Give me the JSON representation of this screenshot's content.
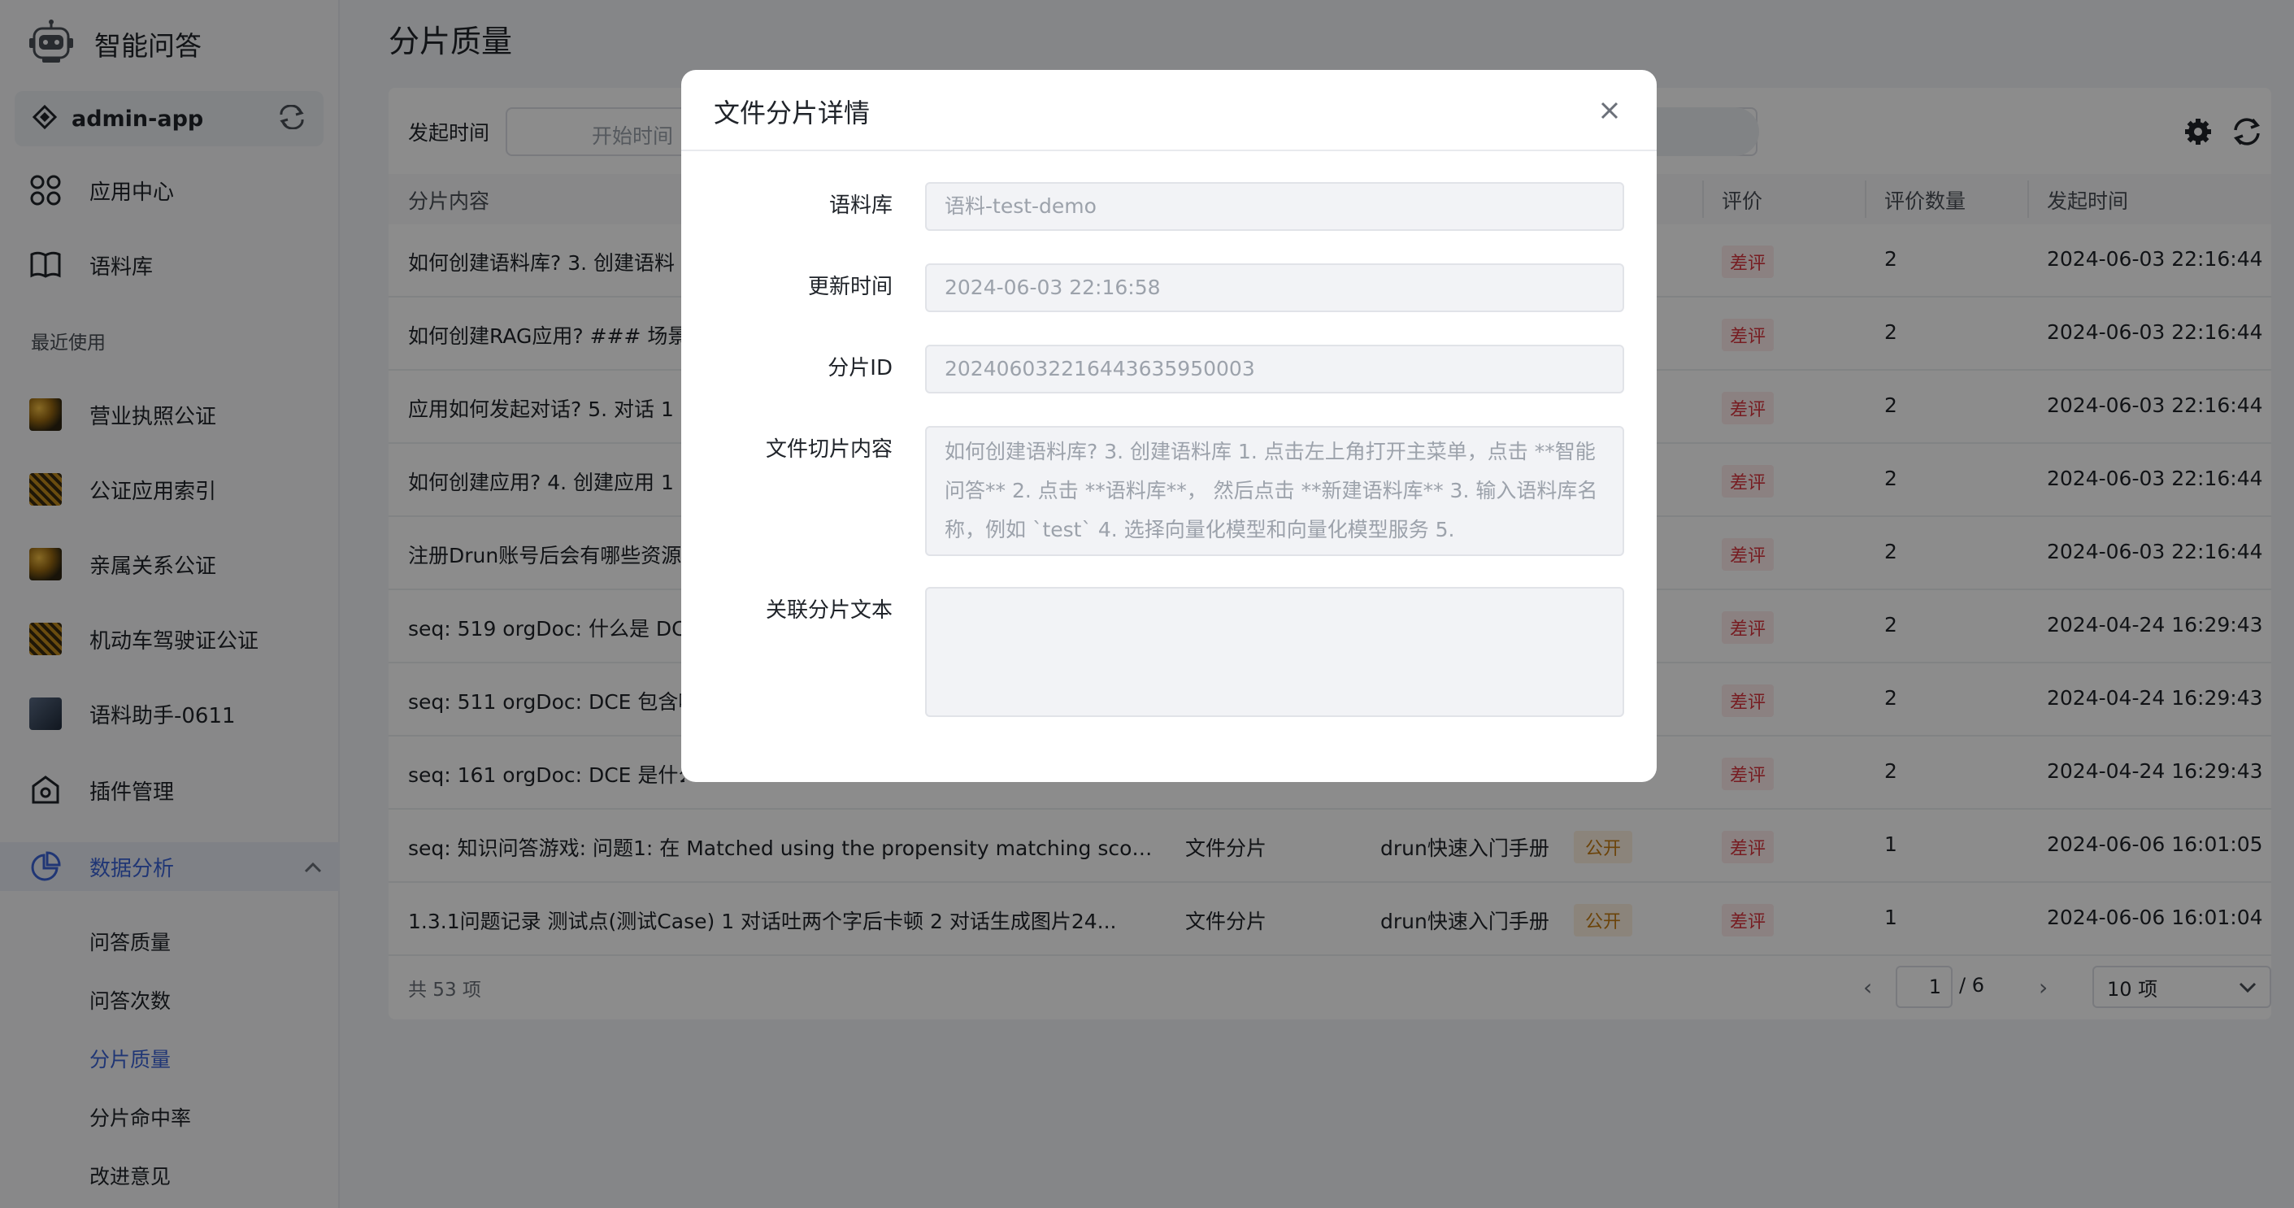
{
  "sidebar": {
    "brand_title": "智能问答",
    "app_name": "admin-app",
    "nav": {
      "app_center": "应用中心",
      "corpus": "语料库"
    },
    "recent_title": "最近使用",
    "recent": [
      {
        "label": "营业执照公证"
      },
      {
        "label": "公证应用索引"
      },
      {
        "label": "亲属关系公证"
      },
      {
        "label": "机动车驾驶证公证"
      },
      {
        "label": "语料助手-0611"
      }
    ],
    "plugin_manage": "插件管理",
    "data_analysis": "数据分析",
    "sub_items": {
      "qa_quality": "问答质量",
      "qa_count": "问答次数",
      "chunk_quality": "分片质量",
      "chunk_hit_rate": "分片命中率",
      "feedback": "改进意见"
    }
  },
  "main": {
    "page_title": "分片质量",
    "filter_label": "发起时间",
    "date_placeholder": "开始时间",
    "columns": {
      "content": "分片内容",
      "rating": "评价",
      "rating_count": "评价数量",
      "time": "发起时间"
    },
    "rows": [
      {
        "content": "如何创建语料库?  3. 创建语料",
        "type": "",
        "corpus": "",
        "visibility": "",
        "rating": "差评",
        "count": "2",
        "time": "2024-06-03 22:16:44"
      },
      {
        "content": "如何创建RAG应用?  ### 场景",
        "type": "",
        "corpus": "",
        "visibility": "",
        "rating": "差评",
        "count": "2",
        "time": "2024-06-03 22:16:44"
      },
      {
        "content": "应用如何发起对话?  5. 对话 1",
        "type": "",
        "corpus": "",
        "visibility": "",
        "rating": "差评",
        "count": "2",
        "time": "2024-06-03 22:16:44"
      },
      {
        "content": "如何创建应用?  4. 创建应用 1",
        "type": "",
        "corpus": "",
        "visibility": "",
        "rating": "差评",
        "count": "2",
        "time": "2024-06-03 22:16:44"
      },
      {
        "content": "注册Drun账号后会有哪些资源",
        "type": "",
        "corpus": "",
        "visibility": "",
        "rating": "差评",
        "count": "2",
        "time": "2024-06-03 22:16:44"
      },
      {
        "content": "seq: 519 orgDoc: 什么是 DCE",
        "type": "",
        "corpus": "",
        "visibility": "",
        "rating": "差评",
        "count": "2",
        "time": "2024-04-24 16:29:43"
      },
      {
        "content": "seq: 511 orgDoc: DCE 包含哪",
        "type": "",
        "corpus": "",
        "visibility": "",
        "rating": "差评",
        "count": "2",
        "time": "2024-04-24 16:29:43"
      },
      {
        "content": "seq: 161 orgDoc: DCE 是什么",
        "type": "",
        "corpus": "",
        "visibility": "",
        "rating": "差评",
        "count": "2",
        "time": "2024-04-24 16:29:43"
      },
      {
        "content": "seq: 知识问答游戏:  问题1:  在 Matched using the propensity matching score...",
        "type": "文件分片",
        "corpus": "drun快速入门手册",
        "visibility": "公开",
        "rating": "差评",
        "count": "1",
        "time": "2024-06-06 16:01:05"
      },
      {
        "content": "1.3.1问题记录 测试点(测试Case) 1 对话吐两个字后卡顿 2 对话生成图片24...",
        "type": "文件分片",
        "corpus": "drun快速入门手册",
        "visibility": "公开",
        "rating": "差评",
        "count": "1",
        "time": "2024-06-06 16:01:04"
      }
    ],
    "total": "共 53 项",
    "page_current": "1",
    "page_total": "/ 6",
    "page_size": "10 项"
  },
  "modal": {
    "title": "文件分片详情",
    "fields": {
      "corpus_label": "语料库",
      "corpus_value": "语料-test-demo",
      "updated_label": "更新时间",
      "updated_value": "2024-06-03 22:16:58",
      "chunk_id_label": "分片ID",
      "chunk_id_value": "20240603221644363595000​3",
      "content_label": "文件切片内容",
      "content_value": " 如何创建语料库?  3. 创建语料库      1. 点击左上角打开主菜单，点击 **智能问答**     2. 点击 **语料库**， 然后点击 **新建语料库**     3. 输入语料库名称，例如 `test`     4. 选择向量化模型和向量化模型服务 5.",
      "related_label": "关联分片文本",
      "related_value": ""
    }
  }
}
